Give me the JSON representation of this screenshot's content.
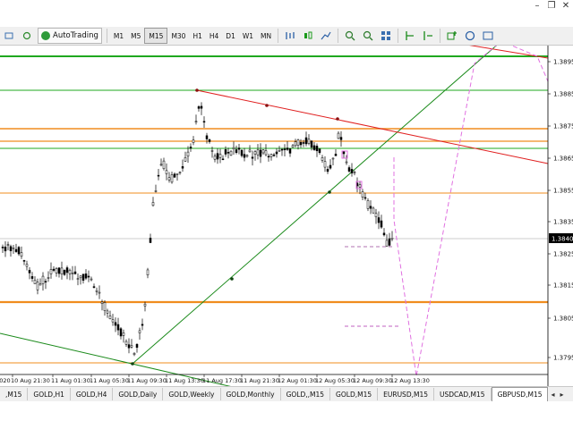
{
  "window_controls": [
    "–",
    "❐",
    "✕"
  ],
  "toolbar": {
    "autotrading_label": "AutoTrading",
    "timeframes": [
      "M1",
      "M5",
      "M15",
      "M30",
      "H1",
      "H4",
      "D1",
      "W1",
      "MN"
    ],
    "active_timeframe": "M15"
  },
  "chart": {
    "symbol": "GBPUSD,M15",
    "current_price": "1.3840",
    "price_axis": [
      "1.3895",
      "1.3885",
      "1.3875",
      "1.3865",
      "1.3855",
      "1.3840",
      "1.3835",
      "1.3825",
      "1.3815",
      "1.3805",
      "1.3795"
    ],
    "time_axis": [
      "10 Aug 2020",
      "10 Aug 21:30",
      "11 Aug 01:30",
      "11 Aug 05:30",
      "11 Aug 09:30",
      "11 Aug 13:30",
      "11 Aug 17:30",
      "11 Aug 21:30",
      "12 Aug 01:30",
      "12 Aug 05:30",
      "12 Aug 09:30",
      "12 Aug 13:30"
    ],
    "colors": {
      "up": "#000000",
      "grid_green": "#1fa81f",
      "orange": "#f08c1e",
      "red_line": "#e02020",
      "projection": "#e070e0",
      "trend_green": "#1a8a1a"
    }
  },
  "tabs": {
    "items": [
      ",M15",
      "GOLD,H1",
      "GOLD,H4",
      "GOLD,Daily",
      "GOLD,Weekly",
      "GOLD,Monthly",
      "GOLD,,M15",
      "GOLD,M15",
      "EURUSD,M15",
      "USDCAD,M15",
      "GBPUSD,M15"
    ],
    "active": "GBPUSD,M15"
  }
}
